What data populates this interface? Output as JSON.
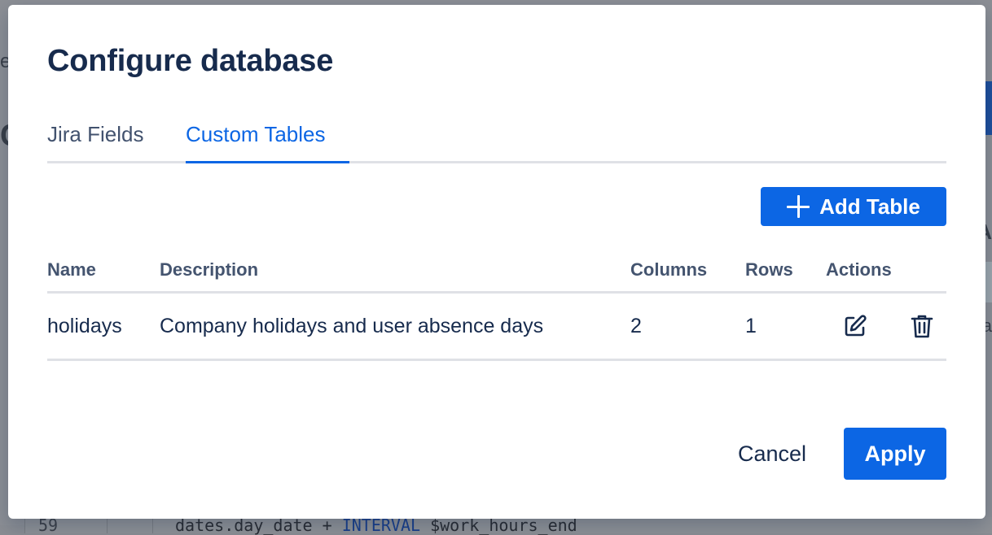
{
  "background": {
    "fragment_e": "e",
    "fragment_c": "C",
    "fragment_k": "A",
    "fragment_a": "a",
    "code_line_number": "59",
    "code_text_prefix": "dates.day_date + ",
    "code_keyword": "INTERVAL",
    "code_text_suffix": " $work_hours_end"
  },
  "modal": {
    "title": "Configure database",
    "tabs": [
      {
        "label": "Jira Fields",
        "selected": false
      },
      {
        "label": "Custom Tables",
        "selected": true
      }
    ],
    "add_table_label": "Add Table",
    "table": {
      "headers": [
        "Name",
        "Description",
        "Columns",
        "Rows",
        "Actions"
      ],
      "rows": [
        {
          "name": "holidays",
          "description": "Company holidays and user absence days",
          "columns": "2",
          "rows": "1"
        }
      ]
    },
    "cancel_label": "Cancel",
    "apply_label": "Apply"
  },
  "icons": {
    "add": "plus-icon",
    "edit": "edit-icon",
    "delete": "trash-icon"
  },
  "colors": {
    "primary": "#0c66e4",
    "text": "#172b4d",
    "muted": "#44546f",
    "divider": "#dfe1e6"
  }
}
